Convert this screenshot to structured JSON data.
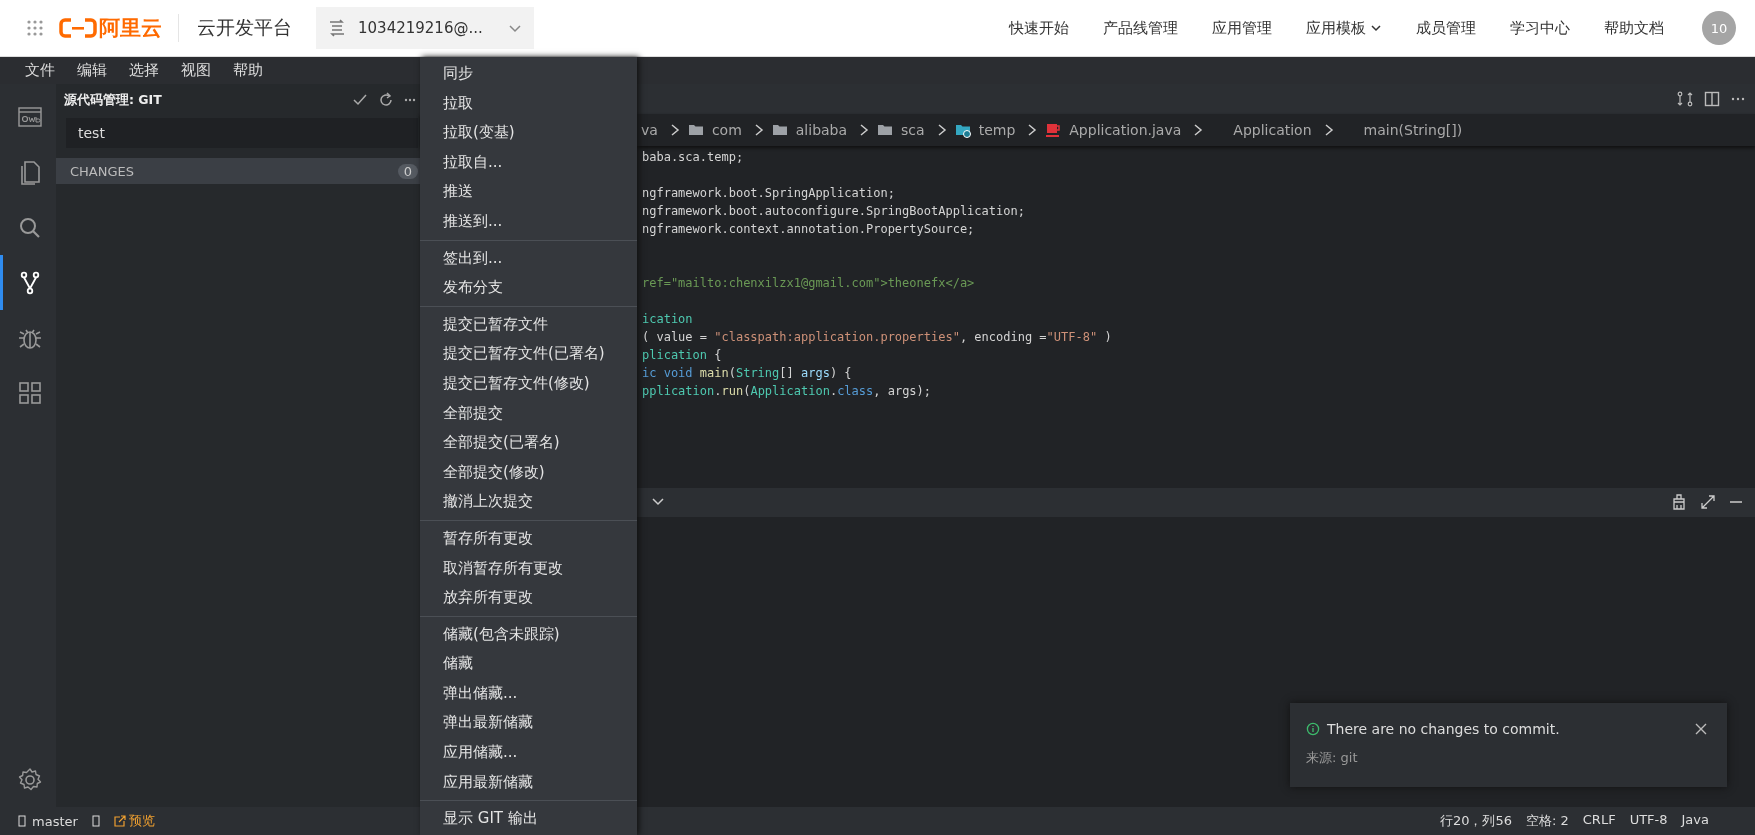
{
  "top_bar": {
    "logo": "阿里云",
    "product": "云开发平台",
    "account": "1034219216@...",
    "nav": [
      {
        "label": "快速开始",
        "dropdown": false
      },
      {
        "label": "产品线管理",
        "dropdown": false
      },
      {
        "label": "应用管理",
        "dropdown": false
      },
      {
        "label": "应用模板",
        "dropdown": true
      },
      {
        "label": "成员管理",
        "dropdown": false
      },
      {
        "label": "学习中心",
        "dropdown": false
      },
      {
        "label": "帮助文档",
        "dropdown": false
      }
    ],
    "avatar": "10"
  },
  "menu_bar": [
    "文件",
    "编辑",
    "选择",
    "视图",
    "帮助"
  ],
  "activity_bar": [
    {
      "selected": false
    },
    {
      "selected": false
    },
    {
      "selected": false
    },
    {
      "selected": true
    },
    {
      "selected": false
    },
    {
      "selected": false
    }
  ],
  "sidebar": {
    "title": "源代码管理: GIT",
    "commit_message": "test",
    "section": "CHANGES",
    "count": "0"
  },
  "context_menu": [
    [
      "同步",
      "拉取",
      "拉取(变基)",
      "拉取自...",
      "推送",
      "推送到..."
    ],
    [
      "签出到...",
      "发布分支"
    ],
    [
      "提交已暂存文件",
      "提交已暂存文件(已署名)",
      "提交已暂存文件(修改)",
      "全部提交",
      "全部提交(已署名)",
      "全部提交(修改)",
      "撤消上次提交"
    ],
    [
      "暂存所有更改",
      "取消暂存所有更改",
      "放弃所有更改"
    ],
    [
      "储藏(包含未跟踪)",
      "储藏",
      "弹出储藏...",
      "弹出最新储藏",
      "应用储藏...",
      "应用最新储藏"
    ],
    [
      "显示 GIT 输出"
    ]
  ],
  "breadcrumb": [
    {
      "kind": "text",
      "label": "va"
    },
    {
      "kind": "folder",
      "label": "com"
    },
    {
      "kind": "folder",
      "label": "alibaba"
    },
    {
      "kind": "folder",
      "label": "sca"
    },
    {
      "kind": "package",
      "label": "temp"
    },
    {
      "kind": "java",
      "label": "Application.java"
    },
    {
      "kind": "symbol",
      "label": "Application"
    },
    {
      "kind": "symbol",
      "label": "main(String[])"
    }
  ],
  "code_lines": [
    {
      "kind": "code",
      "segments": [
        {
          "kind": "plain",
          "text": "baba.sca.temp;"
        }
      ]
    },
    {
      "kind": "blank"
    },
    {
      "kind": "code",
      "segments": [
        {
          "kind": "plain",
          "text": "ngframework.boot.SpringApplication;"
        }
      ]
    },
    {
      "kind": "code",
      "segments": [
        {
          "kind": "plain",
          "text": "ngframework.boot.autoconfigure.SpringBootApplication;"
        }
      ]
    },
    {
      "kind": "code",
      "segments": [
        {
          "kind": "plain",
          "text": "ngframework.context.annotation.PropertySource;"
        }
      ]
    },
    {
      "kind": "blank"
    },
    {
      "kind": "blank"
    },
    {
      "kind": "code",
      "segments": [
        {
          "kind": "comment",
          "text": "ref=\"mailto:chenxilzx1@gmail.com\">theonefx</a>"
        }
      ]
    },
    {
      "kind": "blank"
    },
    {
      "kind": "code",
      "segments": [
        {
          "kind": "type",
          "text": "ication"
        }
      ]
    },
    {
      "kind": "code",
      "segments": [
        {
          "kind": "plain",
          "text": "( value = "
        },
        {
          "kind": "string",
          "text": "\"classpath:application.properties\""
        },
        {
          "kind": "plain",
          "text": ", encoding ="
        },
        {
          "kind": "string",
          "text": "\"UTF-8\""
        },
        {
          "kind": "plain",
          "text": " )"
        }
      ]
    },
    {
      "kind": "code",
      "segments": [
        {
          "kind": "type",
          "text": "plication"
        },
        {
          "kind": "plain",
          "text": " {"
        }
      ]
    },
    {
      "kind": "code",
      "segments": [
        {
          "kind": "keyword",
          "text": "ic void "
        },
        {
          "kind": "func",
          "text": "main"
        },
        {
          "kind": "plain",
          "text": "("
        },
        {
          "kind": "type",
          "text": "String"
        },
        {
          "kind": "plain",
          "text": "[] "
        },
        {
          "kind": "param",
          "text": "args"
        },
        {
          "kind": "plain",
          "text": ") {"
        }
      ]
    },
    {
      "kind": "code",
      "segments": [
        {
          "kind": "type",
          "text": "pplication"
        },
        {
          "kind": "plain",
          "text": "."
        },
        {
          "kind": "func",
          "text": "run"
        },
        {
          "kind": "plain",
          "text": "("
        },
        {
          "kind": "type",
          "text": "Application"
        },
        {
          "kind": "plain",
          "text": "."
        },
        {
          "kind": "keyword",
          "text": "class"
        },
        {
          "kind": "plain",
          "text": ", args);"
        }
      ]
    }
  ],
  "notification": {
    "message": "There are no changes to commit.",
    "source": "来源: git"
  },
  "status_bar": {
    "branch": "master",
    "preview": "预览",
    "right": [
      "行20，列56",
      "空格: 2",
      "CRLF",
      "UTF-8",
      "Java"
    ]
  }
}
